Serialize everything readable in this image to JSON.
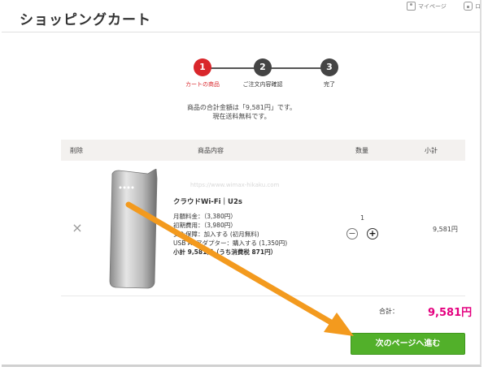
{
  "header": {
    "title": "ショッピングカート",
    "mypage_label": "マイページ",
    "logout_label": "ロ"
  },
  "steps": [
    {
      "number": "1",
      "label": "カートの商品",
      "active": true
    },
    {
      "number": "2",
      "label": "ご注文内容確認",
      "active": false
    },
    {
      "number": "3",
      "label": "完了",
      "active": false
    }
  ],
  "summary": {
    "line1": "商品の合計金額は「9,581円」です。",
    "line2": "現在送料無料です。"
  },
  "table": {
    "headers": {
      "remove": "削除",
      "product": "商品内容",
      "quantity": "数量",
      "subtotal": "小計"
    }
  },
  "item": {
    "watermark": "https://www.wimax-hikaku.com",
    "name": "クラウドWi-Fi｜U2s",
    "details": [
      "月額料金：（3,380円）",
      "初期費用：（3,980円）",
      "安心保障：加入する (初月無料)",
      "USB ACアダプター：購入する (1,350円)"
    ],
    "subtotal_line": "小計 9,581円（うち消費税 871円）",
    "quantity": "1",
    "minus": "−",
    "plus": "+",
    "remove_symbol": "×",
    "line_price": "9,581円"
  },
  "totals": {
    "label": "合計：",
    "value": "9,581円"
  },
  "actions": {
    "next_label": "次のページへ進む"
  },
  "colors": {
    "active_step": "#d9262b",
    "total_price": "#e4007f",
    "next_button": "#52b02a",
    "annotation_arrow": "#f39a1e"
  }
}
